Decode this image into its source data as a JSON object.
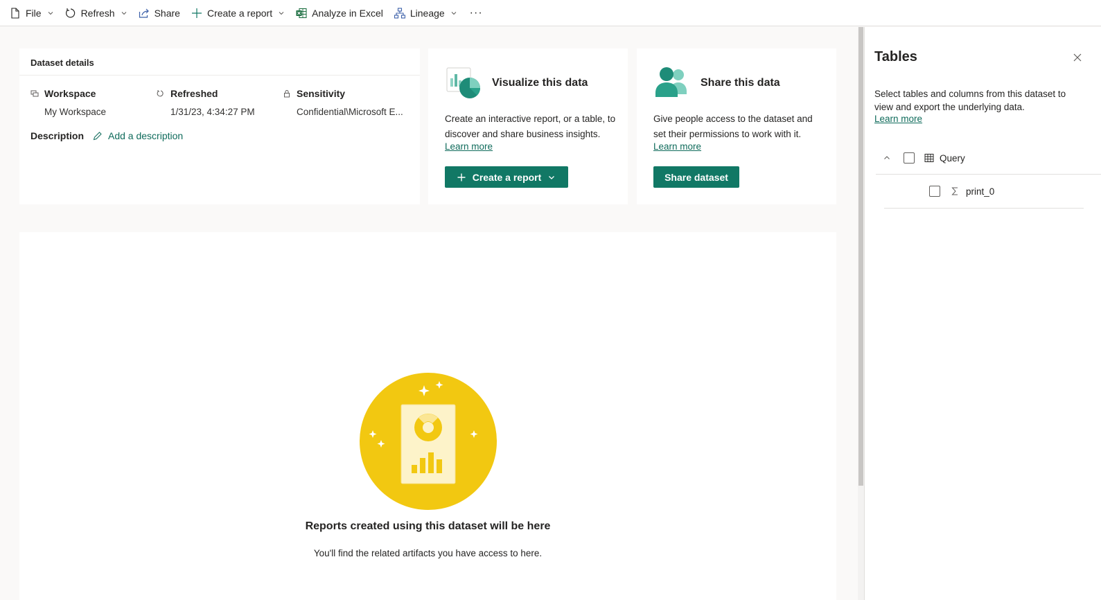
{
  "toolbar": {
    "items": [
      {
        "label": "File",
        "icon": "file-icon",
        "has_chevron": true
      },
      {
        "label": "Refresh",
        "icon": "refresh-icon",
        "has_chevron": true
      },
      {
        "label": "Share",
        "icon": "share-icon",
        "has_chevron": false
      },
      {
        "label": "Create a report",
        "icon": "plus-icon",
        "has_chevron": true
      },
      {
        "label": "Analyze in Excel",
        "icon": "excel-icon",
        "has_chevron": false
      },
      {
        "label": "Lineage",
        "icon": "lineage-icon",
        "has_chevron": true
      }
    ],
    "more_label": "···"
  },
  "details": {
    "title": "Dataset details",
    "workspace_label": "Workspace",
    "workspace_value": "My Workspace",
    "refreshed_label": "Refreshed",
    "refreshed_value": "1/31/23, 4:34:27 PM",
    "sensitivity_label": "Sensitivity",
    "sensitivity_value": "Confidential\\Microsoft E...",
    "description_label": "Description",
    "add_description": "Add a description"
  },
  "visualize": {
    "title": "Visualize this data",
    "body": "Create an interactive report, or a table, to discover and share business insights.",
    "learn_more": "Learn more",
    "button_label": "Create a report"
  },
  "share": {
    "title": "Share this data",
    "body": "Give people access to the dataset and set their permissions to work with it.",
    "learn_more": "Learn more",
    "button_label": "Share dataset"
  },
  "reports": {
    "empty_title": "Reports created using this dataset will be here",
    "empty_subtitle": "You'll find the related artifacts you have access to here."
  },
  "tables_panel": {
    "title": "Tables",
    "description": "Select tables and columns from this dataset to view and export the underlying data.",
    "learn_more": "Learn more",
    "tables": [
      {
        "name": "Query",
        "icon": "table-icon",
        "expanded": true,
        "columns": [
          {
            "name": "print_0",
            "icon": "sigma-icon"
          }
        ]
      }
    ]
  },
  "colors": {
    "accent": "#117865",
    "link": "#0f6b5b",
    "illustration_yellow": "#f2c811"
  }
}
